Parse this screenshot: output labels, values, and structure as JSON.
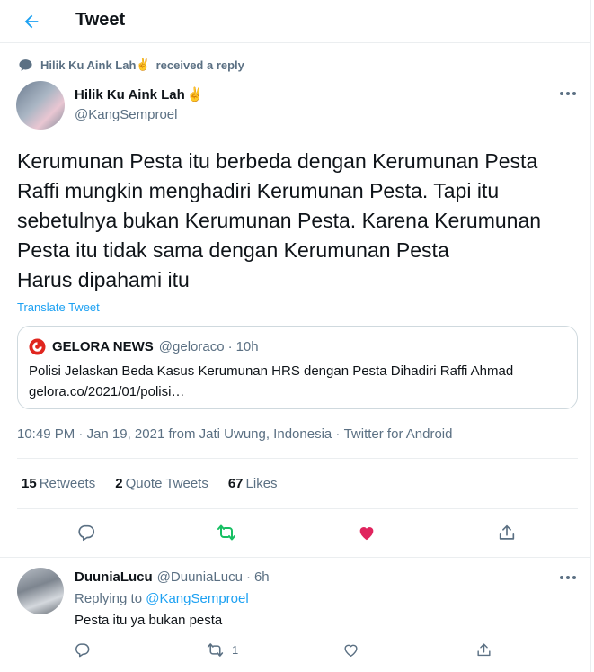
{
  "header": {
    "title": "Tweet",
    "back_icon": "arrow-left-icon"
  },
  "social_context": {
    "name": "Hilik Ku Aink Lah",
    "emoji": "✌️",
    "text": "received a reply"
  },
  "tweet": {
    "author_name": "Hilik Ku Aink Lah",
    "author_emoji": "✌️",
    "author_handle": "@KangSemproel",
    "text": "Kerumunan Pesta itu berbeda dengan Kerumunan Pesta\nRaffi mungkin menghadiri Kerumunan Pesta. Tapi itu\nsebetulnya bukan Kerumunan Pesta. Karena Kerumunan\nPesta itu tidak sama dengan Kerumunan Pesta\nHarus dipahami itu",
    "translate_label": "Translate Tweet",
    "quote": {
      "name": "GELORA NEWS",
      "handle": "@geloraco",
      "sep": "·",
      "time": "10h",
      "line1": "Polisi Jelaskan Beda Kasus Kerumunan HRS dengan Pesta Dihadiri Raffi Ahmad",
      "line2": "gelora.co/2021/01/polisi…",
      "logo_color": "#e0261f"
    },
    "timestamp": {
      "time": "10:49 PM",
      "sep1": " · ",
      "date": "Jan 19, 2021",
      "location": " from Jati Uwung, Indonesia",
      "sep2": " · ",
      "source": "Twitter for Android"
    },
    "stats": {
      "retweets_count": "15",
      "retweets_label": "Retweets",
      "quotes_count": "2",
      "quotes_label": "Quote Tweets",
      "likes_count": "67",
      "likes_label": "Likes"
    }
  },
  "reply": {
    "author_name": "DuuniaLucu",
    "author_handle": "@DuuniaLucu",
    "sep": "·",
    "time": "6h",
    "replying_label": "Replying to",
    "replying_to": "@KangSemproel",
    "text": "Pesta itu ya bukan pesta",
    "retweet_count": "1"
  },
  "colors": {
    "accent": "#1da1f2",
    "retweet_active": "#17bf63",
    "like_active": "#e0245e",
    "secondary_text": "#5b7083",
    "border": "#ebeef0"
  }
}
